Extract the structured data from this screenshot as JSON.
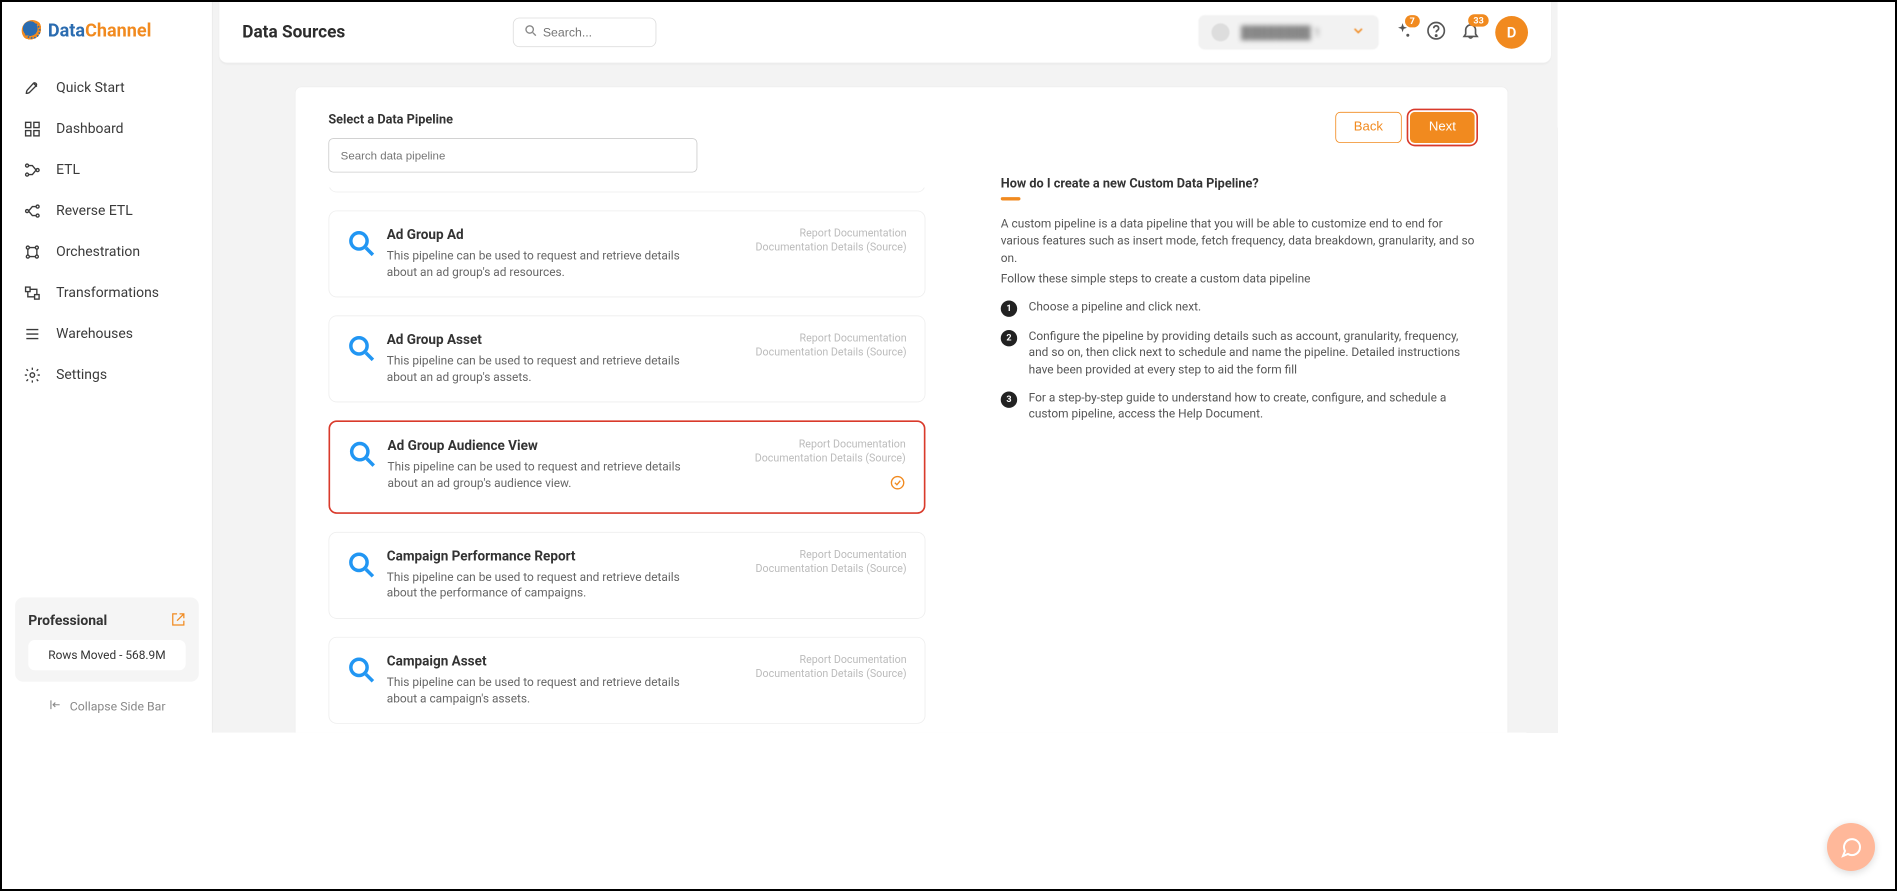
{
  "brand": {
    "part1": "Data",
    "part2": "Channel"
  },
  "nav": {
    "items": [
      {
        "label": "Quick Start",
        "icon": "rocket"
      },
      {
        "label": "Dashboard",
        "icon": "grid"
      },
      {
        "label": "ETL",
        "icon": "etl"
      },
      {
        "label": "Reverse ETL",
        "icon": "reverse-etl"
      },
      {
        "label": "Orchestration",
        "icon": "orchestration"
      },
      {
        "label": "Transformations",
        "icon": "transformations"
      },
      {
        "label": "Warehouses",
        "icon": "warehouses"
      },
      {
        "label": "Settings",
        "icon": "gear"
      }
    ]
  },
  "plan": {
    "name": "Professional",
    "rows": "Rows Moved - 568.9M"
  },
  "collapse": "Collapse Side Bar",
  "header": {
    "title": "Data Sources",
    "search_placeholder": "Search...",
    "account": "████████ 1",
    "sparkle_badge": "7",
    "bell_badge": "33",
    "avatar": "D"
  },
  "panel": {
    "title": "Select a Data Pipeline",
    "search_placeholder": "Search data pipeline",
    "back": "Back",
    "next": "Next"
  },
  "pipelines": [
    {
      "title": "Ad Group Ad",
      "desc": "This pipeline can be used to request and retrieve details about an ad group's ad resources.",
      "link1": "Report Documentation",
      "link2": "Documentation Details (Source)"
    },
    {
      "title": "Ad Group Asset",
      "desc": "This pipeline can be used to request and retrieve details about an ad group's assets.",
      "link1": "Report Documentation",
      "link2": "Documentation Details (Source)"
    },
    {
      "title": "Ad Group Audience View",
      "desc": "This pipeline can be used to request and retrieve details about an ad group's audience view.",
      "link1": "Report Documentation",
      "link2": "Documentation Details (Source)",
      "selected": true
    },
    {
      "title": "Campaign Performance Report",
      "desc": "This pipeline can be used to request and retrieve details about the performance of campaigns.",
      "link1": "Report Documentation",
      "link2": "Documentation Details (Source)"
    },
    {
      "title": "Campaign Asset",
      "desc": "This pipeline can be used to request and retrieve details about a campaign's assets.",
      "link1": "Report Documentation",
      "link2": "Documentation Details (Source)"
    }
  ],
  "help": {
    "title": "How do I create a new Custom Data Pipeline?",
    "para1": "A custom pipeline is a data pipeline that you will be able to customize end to end for various features such as insert mode, fetch frequency, data breakdown, granularity, and so on.",
    "para2": "Follow these simple steps to create a custom data pipeline",
    "steps": [
      "Choose a pipeline and click next.",
      "Configure the pipeline by providing details such as account, granularity, frequency, and so on, then click next to schedule and name the pipeline. Detailed instructions have been provided at every step to aid the form fill",
      "For a step-by-step guide to understand how to create, configure, and schedule a custom pipeline, access the Help Document."
    ]
  }
}
